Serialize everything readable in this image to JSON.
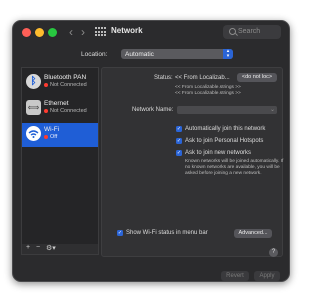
{
  "window": {
    "title": "Network",
    "search_placeholder": "Search",
    "back_glyph": "‹",
    "forward_glyph": "›"
  },
  "location": {
    "label": "Location:",
    "value": "Automatic"
  },
  "sidebar": {
    "items": [
      {
        "name": "Bluetooth PAN",
        "status": "Not Connected",
        "status_color": "#ff3b30",
        "icon": "bluetooth-icon",
        "glyph": "ᛒ",
        "selected": false
      },
      {
        "name": "Ethernet",
        "status": "Not Connected",
        "status_color": "#ff3b30",
        "icon": "ethernet-icon",
        "glyph": "⟺",
        "selected": false
      },
      {
        "name": "Wi-Fi",
        "status": "Off",
        "status_color": "#ff3b30",
        "icon": "wifi-icon",
        "glyph": "◠",
        "selected": true
      }
    ],
    "tools": {
      "add": "+",
      "remove": "−",
      "action": "⚙︎▾"
    }
  },
  "panel": {
    "status_label": "Status:",
    "status_value": "<< From Localizab...",
    "do_not_loc_button": "<do not loc>",
    "status_line2": "<< From Localizable.strings >>",
    "status_line3": "<< From Localizable.strings >>",
    "network_name_label": "Network Name:",
    "checkboxes": [
      {
        "label": "Automatically join this network",
        "checked": true
      },
      {
        "label": "Ask to join Personal Hotspots",
        "checked": true
      },
      {
        "label": "Ask to join new networks",
        "checked": true
      }
    ],
    "ask_note_lines": [
      "Known networks will be joined automatically. If",
      "no known networks are available, you will be",
      "asked before joining a new network."
    ],
    "show_wifi_label": "Show Wi-Fi status in menu bar",
    "show_wifi_checked": true,
    "advanced_button": "Advanced...",
    "help_button": "?"
  },
  "footer": {
    "revert_button": "Revert",
    "apply_button": "Apply"
  },
  "colors": {
    "accent": "#2a64d6",
    "window_bg": "#2b2b2d",
    "selected_row": "#1f5ed6"
  }
}
